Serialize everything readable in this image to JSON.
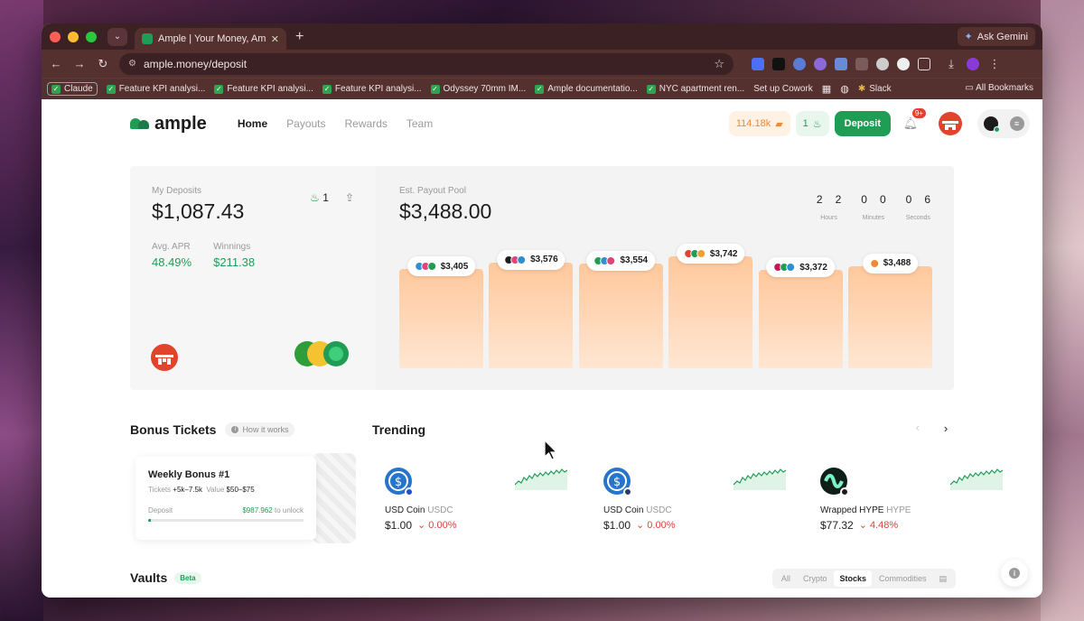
{
  "browser": {
    "tab_title": "Ample | Your Money, Amplifie",
    "ask_gemini": "Ask Gemini",
    "url": "ample.money/deposit",
    "bookmarks": [
      {
        "label": "Claude"
      },
      {
        "label": "Feature KPI analysi..."
      },
      {
        "label": "Feature KPI analysi..."
      },
      {
        "label": "Feature KPI analysi..."
      },
      {
        "label": "Odyssey 70mm IM..."
      },
      {
        "label": "Ample documentatio..."
      },
      {
        "label": "NYC apartment ren..."
      },
      {
        "label": "Set up Cowork"
      },
      {
        "label": "Slack"
      }
    ],
    "all_bookmarks": "All Bookmarks"
  },
  "header": {
    "logo": "ample",
    "nav": [
      "Home",
      "Payouts",
      "Rewards",
      "Team"
    ],
    "tickets": "114.18k",
    "streak": "1",
    "deposit_button": "Deposit",
    "notifications_badge": "9+"
  },
  "deposits": {
    "label": "My Deposits",
    "amount": "$1,087.43",
    "streak": "1",
    "apr_label": "Avg. APR",
    "apr_value": "48.49%",
    "winnings_label": "Winnings",
    "winnings_value": "$211.38"
  },
  "pool": {
    "label": "Est. Payout Pool",
    "amount": "$3,488.00",
    "countdown": {
      "hours": [
        "2",
        "2"
      ],
      "hours_label": "Hours",
      "minutes": [
        "0",
        "0"
      ],
      "minutes_label": "Minutes",
      "seconds": [
        "0",
        "6"
      ],
      "seconds_label": "Seconds"
    },
    "bars": [
      {
        "label": "$3,405",
        "value": 3405,
        "colors": [
          "#2f8fd1",
          "#e0447a",
          "#1f9d55"
        ]
      },
      {
        "label": "$3,576",
        "value": 3576,
        "colors": [
          "#1c1c1c",
          "#e0447a",
          "#2f8fd1"
        ]
      },
      {
        "label": "$3,554",
        "value": 3554,
        "colors": [
          "#1f9d55",
          "#2f8fd1",
          "#e0447a"
        ]
      },
      {
        "label": "$3,742",
        "value": 3742,
        "colors": [
          "#e0442c",
          "#1f9d55",
          "#f0a030"
        ]
      },
      {
        "label": "$3,372",
        "value": 3372,
        "colors": [
          "#c2185b",
          "#1f9d55",
          "#2f8fd1"
        ]
      },
      {
        "label": "$3,488",
        "value": 3488,
        "colors": [
          "#f08a35"
        ]
      }
    ]
  },
  "bonus": {
    "title": "Bonus Tickets",
    "how_it_works": "How it works",
    "card_title": "Weekly Bonus #1",
    "tickets_label": "Tickets",
    "tickets_value": "+5k–7.5k",
    "value_label": "Value",
    "value_value": "$50–$75",
    "deposit_label": "Deposit",
    "deposit_amount": "$987.962",
    "unlock_label": "to unlock",
    "progress": 0.02
  },
  "trending": {
    "title": "Trending",
    "items": [
      {
        "name": "USD Coin",
        "ticker": "USDC",
        "price": "$1.00",
        "change": "0.00%",
        "color": "#2775ca",
        "sub": "#1b4fd8"
      },
      {
        "name": "USD Coin",
        "ticker": "USDC",
        "price": "$1.00",
        "change": "0.00%",
        "color": "#2775ca",
        "sub": "#2a3a6a"
      },
      {
        "name": "Wrapped HYPE",
        "ticker": "HYPE",
        "price": "$77.32",
        "change": "4.48%",
        "color": "#0e1f1a",
        "sub": "#1c1c1c"
      }
    ]
  },
  "vaults": {
    "title": "Vaults",
    "beta": "Beta",
    "filters": [
      "All",
      "Crypto",
      "Stocks",
      "Commodities"
    ],
    "selected_filter": "Stocks"
  },
  "colors": {
    "brand_green": "#1f9d55",
    "accent_orange": "#f08a35",
    "down_red": "#d6453f"
  }
}
